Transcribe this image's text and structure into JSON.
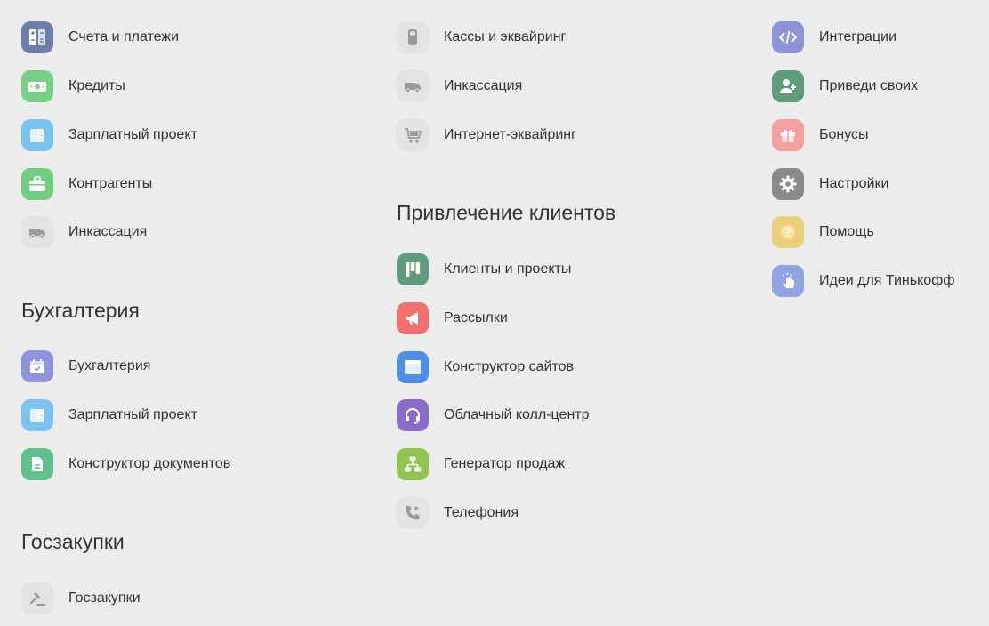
{
  "column1": {
    "items": [
      {
        "label": "Счета и платежи",
        "icon": "calculator-icon",
        "color": "#6f7ea8"
      },
      {
        "label": "Кредиты",
        "icon": "money-icon",
        "color": "#79cf86"
      },
      {
        "label": "Зарплатный проект",
        "icon": "wallet-icon",
        "color": "#7cc4f0"
      },
      {
        "label": "Контрагенты",
        "icon": "briefcase-icon",
        "color": "#6fcf7f"
      },
      {
        "label": "Инкассация",
        "icon": "van-icon",
        "color": "#e3e3e3"
      }
    ],
    "accounting": {
      "title": "Бухгалтерия",
      "items": [
        {
          "label": "Бухгалтерия",
          "icon": "calendar-icon",
          "color": "#8d95d8"
        },
        {
          "label": "Зарплатный проект",
          "icon": "wallet-icon",
          "color": "#7cc4f0"
        },
        {
          "label": "Конструктор документов",
          "icon": "document-icon",
          "color": "#5fbf8d"
        }
      ]
    },
    "procurement": {
      "title": "Госзакупки",
      "items": [
        {
          "label": "Госзакупки",
          "icon": "gavel-icon",
          "color": "#e3e3e3"
        }
      ]
    }
  },
  "column2": {
    "items": [
      {
        "label": "Кассы и эквайринг",
        "icon": "pos-terminal-icon",
        "color": "#e3e3e3"
      },
      {
        "label": "Инкассация",
        "icon": "van-icon",
        "color": "#e3e3e3"
      },
      {
        "label": "Интернет-эквайринг",
        "icon": "cart-icon",
        "color": "#e3e3e3"
      }
    ],
    "clients": {
      "title": "Привлечение клиентов",
      "items": [
        {
          "label": "Клиенты и проекты",
          "icon": "kanban-icon",
          "color": "#5f9c7c"
        },
        {
          "label": "Рассылки",
          "icon": "megaphone-icon",
          "color": "#f06f6f"
        },
        {
          "label": "Конструктор сайтов",
          "icon": "browser-icon",
          "color": "#4f8fe3"
        },
        {
          "label": "Облачный колл-центр",
          "icon": "headset-icon",
          "color": "#8a6cc8"
        },
        {
          "label": "Генератор продаж",
          "icon": "sitemap-icon",
          "color": "#8fc44f"
        },
        {
          "label": "Телефония",
          "icon": "phone-icon",
          "color": "#e3e3e3"
        }
      ]
    }
  },
  "column3": {
    "items": [
      {
        "label": "Интеграции",
        "icon": "code-icon",
        "color": "#8d95d8"
      },
      {
        "label": "Приведи своих",
        "icon": "add-user-icon",
        "color": "#5f9c7c"
      },
      {
        "label": "Бонусы",
        "icon": "gift-icon",
        "color": "#f5a0a0"
      },
      {
        "label": "Настройки",
        "icon": "gear-icon",
        "color": "#8a8a8a"
      },
      {
        "label": "Помощь",
        "icon": "help-icon",
        "color": "#edcf7a"
      },
      {
        "label": "Идеи для Тинькофф",
        "icon": "idea-hand-icon",
        "color": "#8fa5e0"
      }
    ]
  }
}
